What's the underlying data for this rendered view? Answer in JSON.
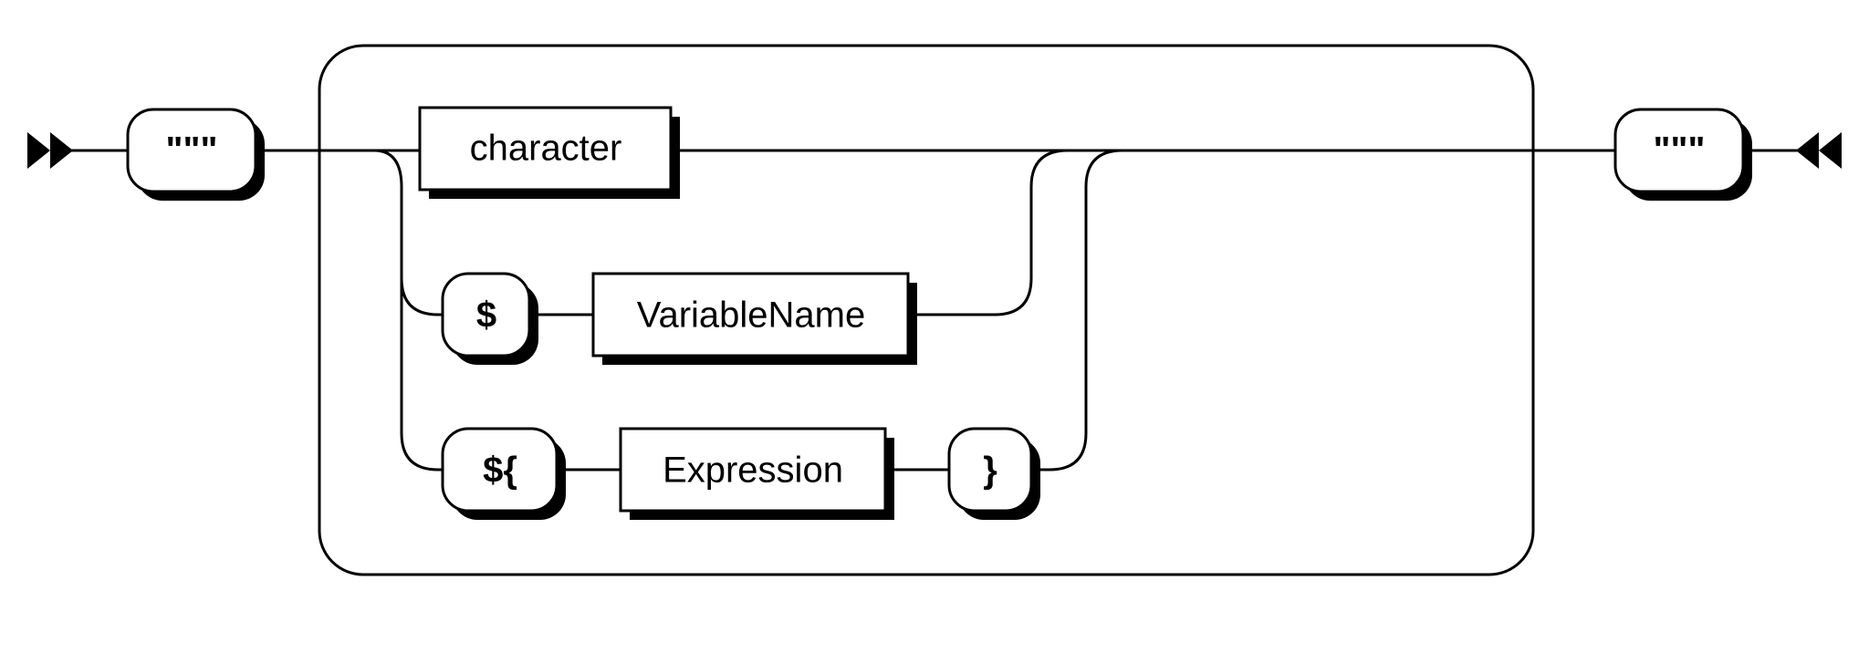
{
  "diagram": {
    "type": "railroad",
    "start_terminal": "\"\"\"",
    "end_terminal": "\"\"\"",
    "alternatives": [
      {
        "kind": "nonterminal",
        "label": "character"
      },
      {
        "kind": "sequence",
        "items": [
          {
            "kind": "terminal",
            "label": "$"
          },
          {
            "kind": "nonterminal",
            "label": "VariableName"
          }
        ]
      },
      {
        "kind": "sequence",
        "items": [
          {
            "kind": "terminal",
            "label": "${"
          },
          {
            "kind": "nonterminal",
            "label": "Expression"
          },
          {
            "kind": "terminal",
            "label": "}"
          }
        ]
      }
    ],
    "loop": true
  }
}
